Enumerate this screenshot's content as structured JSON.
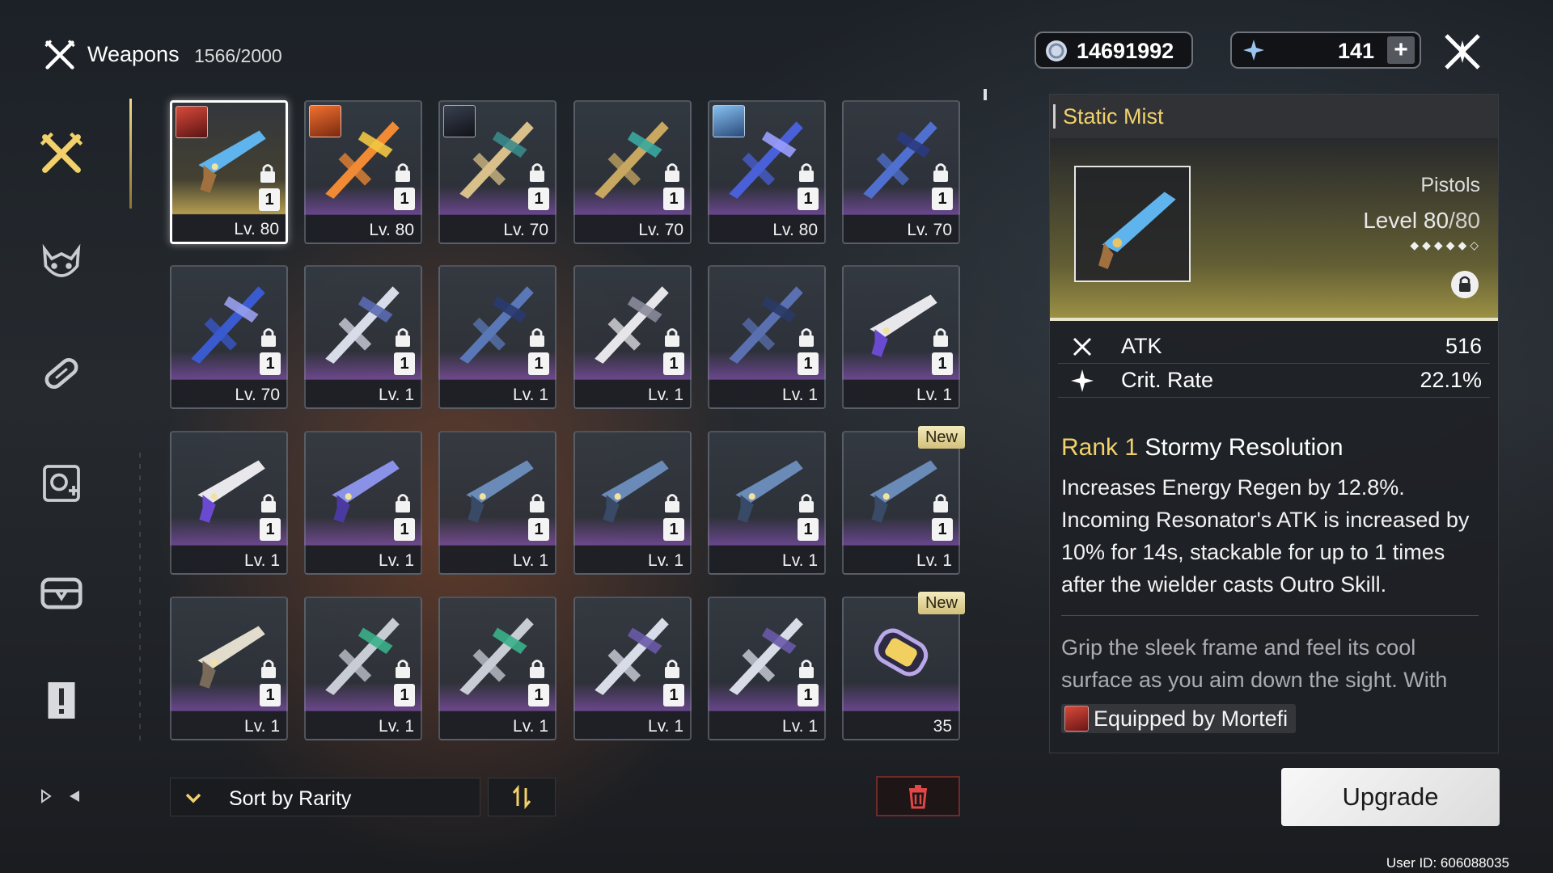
{
  "header": {
    "title": "Weapons",
    "count": "1566/2000",
    "icon": "crossed-swords-icon"
  },
  "sidebar": {
    "items": [
      {
        "name": "weapons",
        "icon": "crossed-swords-icon",
        "active": true
      },
      {
        "name": "echoes",
        "icon": "echo-mask-icon",
        "active": false
      },
      {
        "name": "development-materials",
        "icon": "capsule-icon",
        "active": false
      },
      {
        "name": "supplies",
        "icon": "gear-badge-icon",
        "active": false
      },
      {
        "name": "resources",
        "icon": "chest-icon",
        "active": false
      },
      {
        "name": "quest-items",
        "icon": "exclamation-document-icon",
        "active": false
      }
    ]
  },
  "currencies": {
    "shell_credit": {
      "value": "14691992",
      "icon": "shell-coin-icon"
    },
    "astrite": {
      "value": "141",
      "icon": "star-crystal-icon"
    },
    "add_label": "+"
  },
  "grid": {
    "items": [
      {
        "art": "pistol-blue",
        "rarity": "gold",
        "rank": "1",
        "level": "Lv. 80",
        "locked": true,
        "avatar": "red-hair",
        "selected": true
      },
      {
        "art": "flame-rectifier",
        "rarity": "purple",
        "rank": "1",
        "level": "Lv. 80",
        "locked": true,
        "avatar": "orange-hair"
      },
      {
        "art": "spear-gold",
        "rarity": "purple",
        "rank": "1",
        "level": "Lv. 70",
        "locked": true,
        "avatar": "dark-hair"
      },
      {
        "art": "broadblade-gold",
        "rarity": "purple",
        "rank": "1",
        "level": "Lv. 70",
        "locked": true
      },
      {
        "art": "rectifier-blue",
        "rarity": "purple",
        "rank": "1",
        "level": "Lv. 80",
        "locked": true,
        "avatar": "blue-hair"
      },
      {
        "art": "rifle-blue",
        "rarity": "purple",
        "rank": "1",
        "level": "Lv. 70",
        "locked": true
      },
      {
        "art": "blade-blue",
        "rarity": "purple",
        "rank": "1",
        "level": "Lv. 70",
        "locked": true
      },
      {
        "art": "rectifier-silver",
        "rarity": "purple",
        "rank": "1",
        "level": "Lv. 1",
        "locked": true
      },
      {
        "art": "rectifier-navy",
        "rarity": "purple",
        "rank": "1",
        "level": "Lv. 1",
        "locked": true
      },
      {
        "art": "rectifier-white",
        "rarity": "purple",
        "rank": "1",
        "level": "Lv. 1",
        "locked": true
      },
      {
        "art": "broadblade-navy",
        "rarity": "purple",
        "rank": "1",
        "level": "Lv. 1",
        "locked": true
      },
      {
        "art": "pistol-white",
        "rarity": "purple",
        "rank": "1",
        "level": "Lv. 1",
        "locked": true
      },
      {
        "art": "pistol-white",
        "rarity": "purple",
        "rank": "1",
        "level": "Lv. 1",
        "locked": true
      },
      {
        "art": "pistol-violet",
        "rarity": "purple",
        "rank": "1",
        "level": "Lv. 1",
        "locked": true
      },
      {
        "art": "pistol-steel",
        "rarity": "purple",
        "rank": "1",
        "level": "Lv. 1",
        "locked": true
      },
      {
        "art": "pistol-steel",
        "rarity": "purple",
        "rank": "1",
        "level": "Lv. 1",
        "locked": true
      },
      {
        "art": "pistol-steel",
        "rarity": "purple",
        "rank": "1",
        "level": "Lv. 1",
        "locked": true
      },
      {
        "art": "pistol-steel",
        "rarity": "purple",
        "rank": "1",
        "level": "Lv. 1",
        "locked": true,
        "badge": "New"
      },
      {
        "art": "revolver-cream",
        "rarity": "purple",
        "rank": "1",
        "level": "Lv. 1",
        "locked": true
      },
      {
        "art": "sword-dual",
        "rarity": "purple",
        "rank": "1",
        "level": "Lv. 1",
        "locked": true
      },
      {
        "art": "sword-dual",
        "rarity": "purple",
        "rank": "1",
        "level": "Lv. 1",
        "locked": true
      },
      {
        "art": "gauntlet-spiked",
        "rarity": "purple",
        "rank": "1",
        "level": "Lv. 1",
        "locked": true
      },
      {
        "art": "gauntlet-spiked",
        "rarity": "purple",
        "rank": "1",
        "level": "Lv. 1",
        "locked": true
      },
      {
        "art": "energy-core",
        "rarity": "purple",
        "rank": "",
        "level": "35",
        "locked": false,
        "badge": "New"
      }
    ]
  },
  "bottom_bar": {
    "sort_label": "Sort by Rarity",
    "sort_icon": "chevron-down-icon",
    "order_icon": "sort-order-icon",
    "delete_icon": "trash-icon"
  },
  "detail": {
    "title": "Static Mist",
    "type": "Pistols",
    "level_label": "Level",
    "level_current": "80",
    "level_max": "/80",
    "stars": "◆◆◆◆◆◇",
    "stats": [
      {
        "icon": "attack-icon",
        "name": "ATK",
        "value": "516"
      },
      {
        "icon": "crit-icon",
        "name": "Crit. Rate",
        "value": "22.1%"
      }
    ],
    "skill_rank": "Rank 1",
    "skill_name": "Stormy Resolution",
    "skill_desc": "Increases Energy Regen by 12.8%. Incoming Resonator's ATK is increased by 10% for 14s, stackable for up to 1 times after the wielder casts Outro Skill.",
    "flavor": "Grip the sleek frame and feel its cool surface as you aim down the sight. With",
    "equipped": "Equipped by Mortefi"
  },
  "actions": {
    "upgrade_label": "Upgrade"
  },
  "footer": {
    "user_id": "User ID: 606088035"
  },
  "colors": {
    "accent_gold": "#f2d16a",
    "rarity_purple": "#9a62c8",
    "rarity_gold": "#c4aa54"
  }
}
